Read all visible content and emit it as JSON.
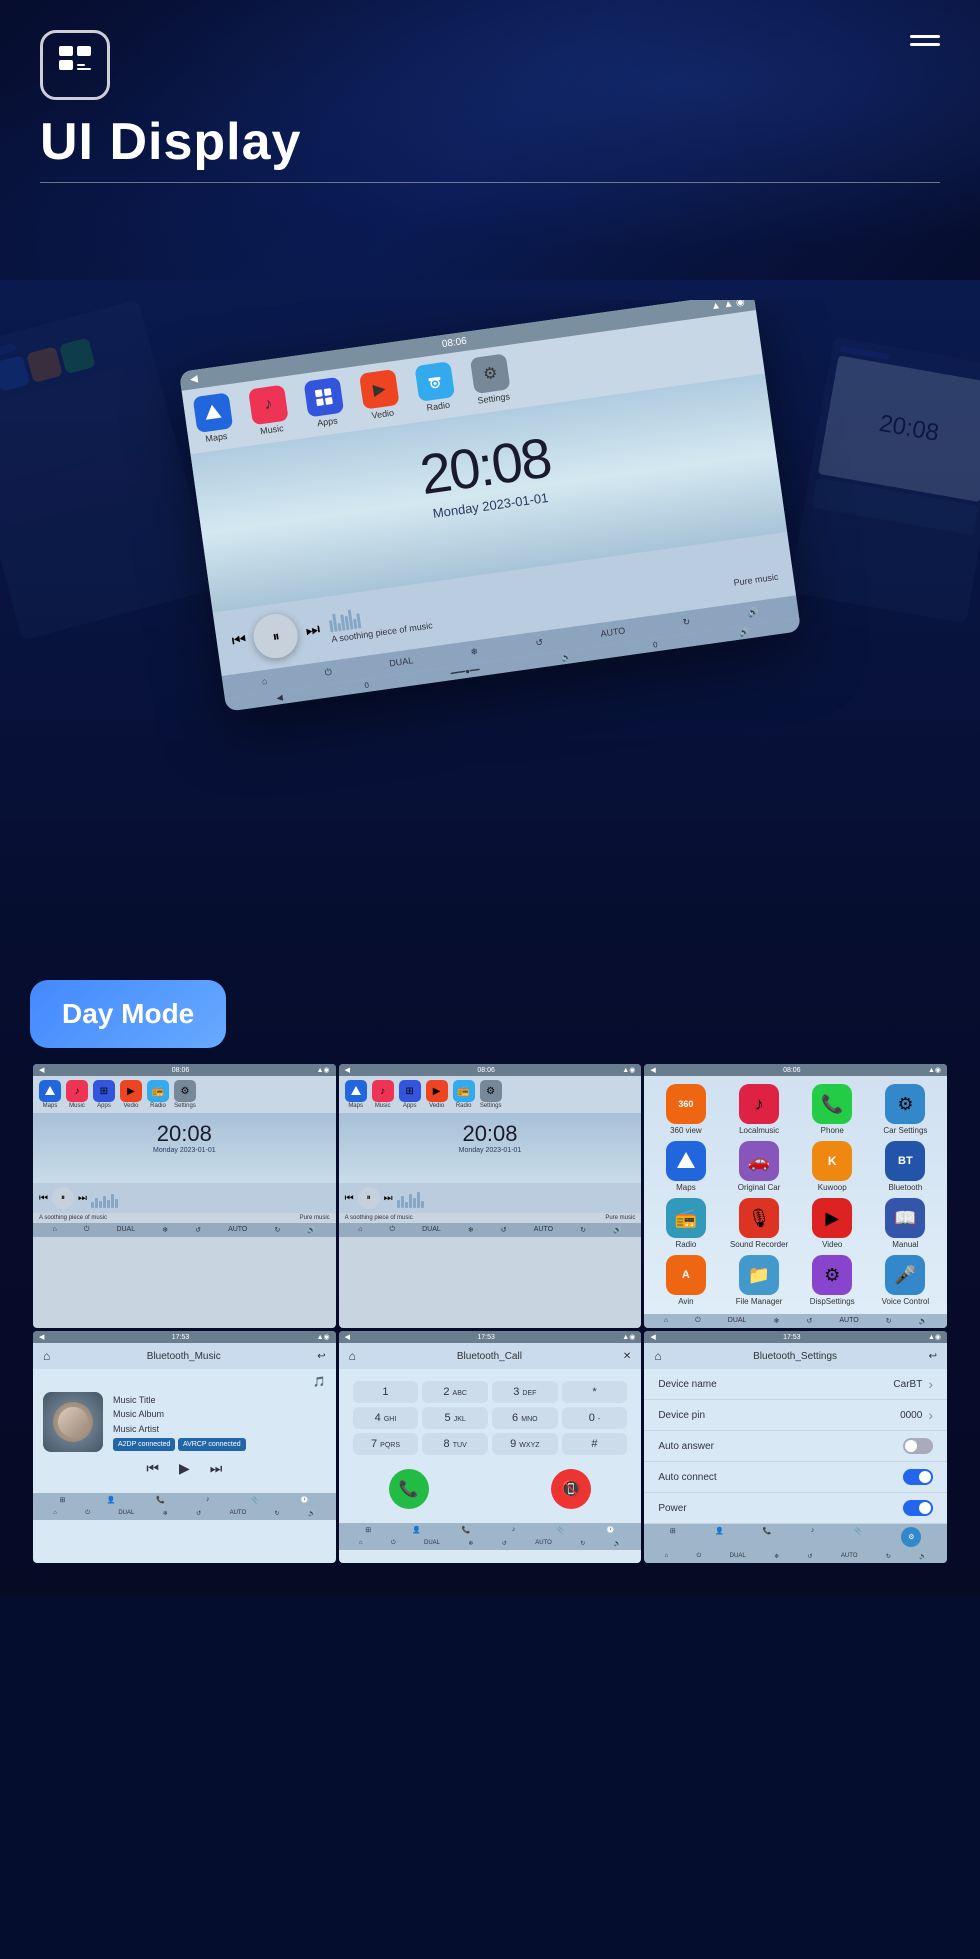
{
  "header": {
    "logo_icon": "≡",
    "title": "UI Display",
    "menu_label": "Menu"
  },
  "hero": {
    "time": "20:08",
    "date": "Monday  2023-01-01",
    "music_title": "A soothing piece of music",
    "music_label": "Pure music"
  },
  "day_mode": {
    "label": "Day Mode",
    "col1": {
      "time": "20:08",
      "date": "Monday  2023-01-01",
      "music": "A soothing piece of music",
      "music_right": "Pure music"
    },
    "col2": {
      "time": "20:08",
      "date": "Monday  2023-01-01",
      "music": "A soothing piece of music",
      "music_right": "Pure music"
    }
  },
  "nav_apps": [
    {
      "label": "Maps",
      "color": "#2266dd",
      "icon": "▲"
    },
    {
      "label": "Music",
      "color": "#ee3355",
      "icon": "♪"
    },
    {
      "label": "Apps",
      "color": "#2244cc",
      "icon": "⊞"
    },
    {
      "label": "Vedio",
      "color": "#ee4422",
      "icon": "▶"
    },
    {
      "label": "Radio",
      "color": "#33aaee",
      "icon": "📻"
    },
    {
      "label": "Settings",
      "color": "#888",
      "icon": "⚙"
    }
  ],
  "app_grid": [
    {
      "label": "360 view",
      "color": "#ee6611",
      "icon": "360"
    },
    {
      "label": "Localmusic",
      "color": "#dd2244",
      "icon": "♪"
    },
    {
      "label": "Phone",
      "color": "#22cc44",
      "icon": "📞"
    },
    {
      "label": "Car Settings",
      "color": "#3388cc",
      "icon": "⚙"
    },
    {
      "label": "Maps",
      "color": "#2266dd",
      "icon": "▲"
    },
    {
      "label": "Original Car",
      "color": "#8855bb",
      "icon": "🚗"
    },
    {
      "label": "Kuwoop",
      "color": "#ee8811",
      "icon": "K"
    },
    {
      "label": "Bluetooth",
      "color": "#2255aa",
      "icon": "BT"
    },
    {
      "label": "Radio",
      "color": "#3399bb",
      "icon": "📻"
    },
    {
      "label": "Sound Recorder",
      "color": "#dd3322",
      "icon": "🎙"
    },
    {
      "label": "Video",
      "color": "#dd2222",
      "icon": "▶"
    },
    {
      "label": "Manual",
      "color": "#3355aa",
      "icon": "📖"
    },
    {
      "label": "Avin",
      "color": "#ee6611",
      "icon": "A"
    },
    {
      "label": "File Manager",
      "color": "#4499cc",
      "icon": "📁"
    },
    {
      "label": "DispSettings",
      "color": "#8844cc",
      "icon": "⚙"
    },
    {
      "label": "Voice Control",
      "color": "#3388cc",
      "icon": "🎤"
    }
  ],
  "bluetooth_music": {
    "header_title": "Bluetooth_Music",
    "time": "17:53",
    "music_title": "Music Title",
    "music_album": "Music Album",
    "music_artist": "Music Artist",
    "badge1": "A2DP connected",
    "badge2": "AVRCP connected"
  },
  "bluetooth_call": {
    "header_title": "Bluetooth_Call",
    "time": "17:53",
    "keys": [
      "1",
      "2 ABC",
      "3 DEF",
      "*",
      "4 GHI",
      "5 JKL",
      "6 MNO",
      "0 -",
      "7 PQRS",
      "8 TUV",
      "9 WXYZ",
      "#"
    ]
  },
  "bluetooth_settings": {
    "header_title": "Bluetooth_Settings",
    "time": "17:53",
    "device_name_label": "Device name",
    "device_name_value": "CarBT",
    "device_pin_label": "Device pin",
    "device_pin_value": "0000",
    "auto_answer_label": "Auto answer",
    "auto_answer_state": "off",
    "auto_connect_label": "Auto connect",
    "auto_connect_state": "on",
    "power_label": "Power",
    "power_state": "on"
  },
  "top_bar_time_1": "08:06",
  "top_bar_time_2": "08:06",
  "top_bar_time_3": "08:06",
  "bt_time": "17:53"
}
